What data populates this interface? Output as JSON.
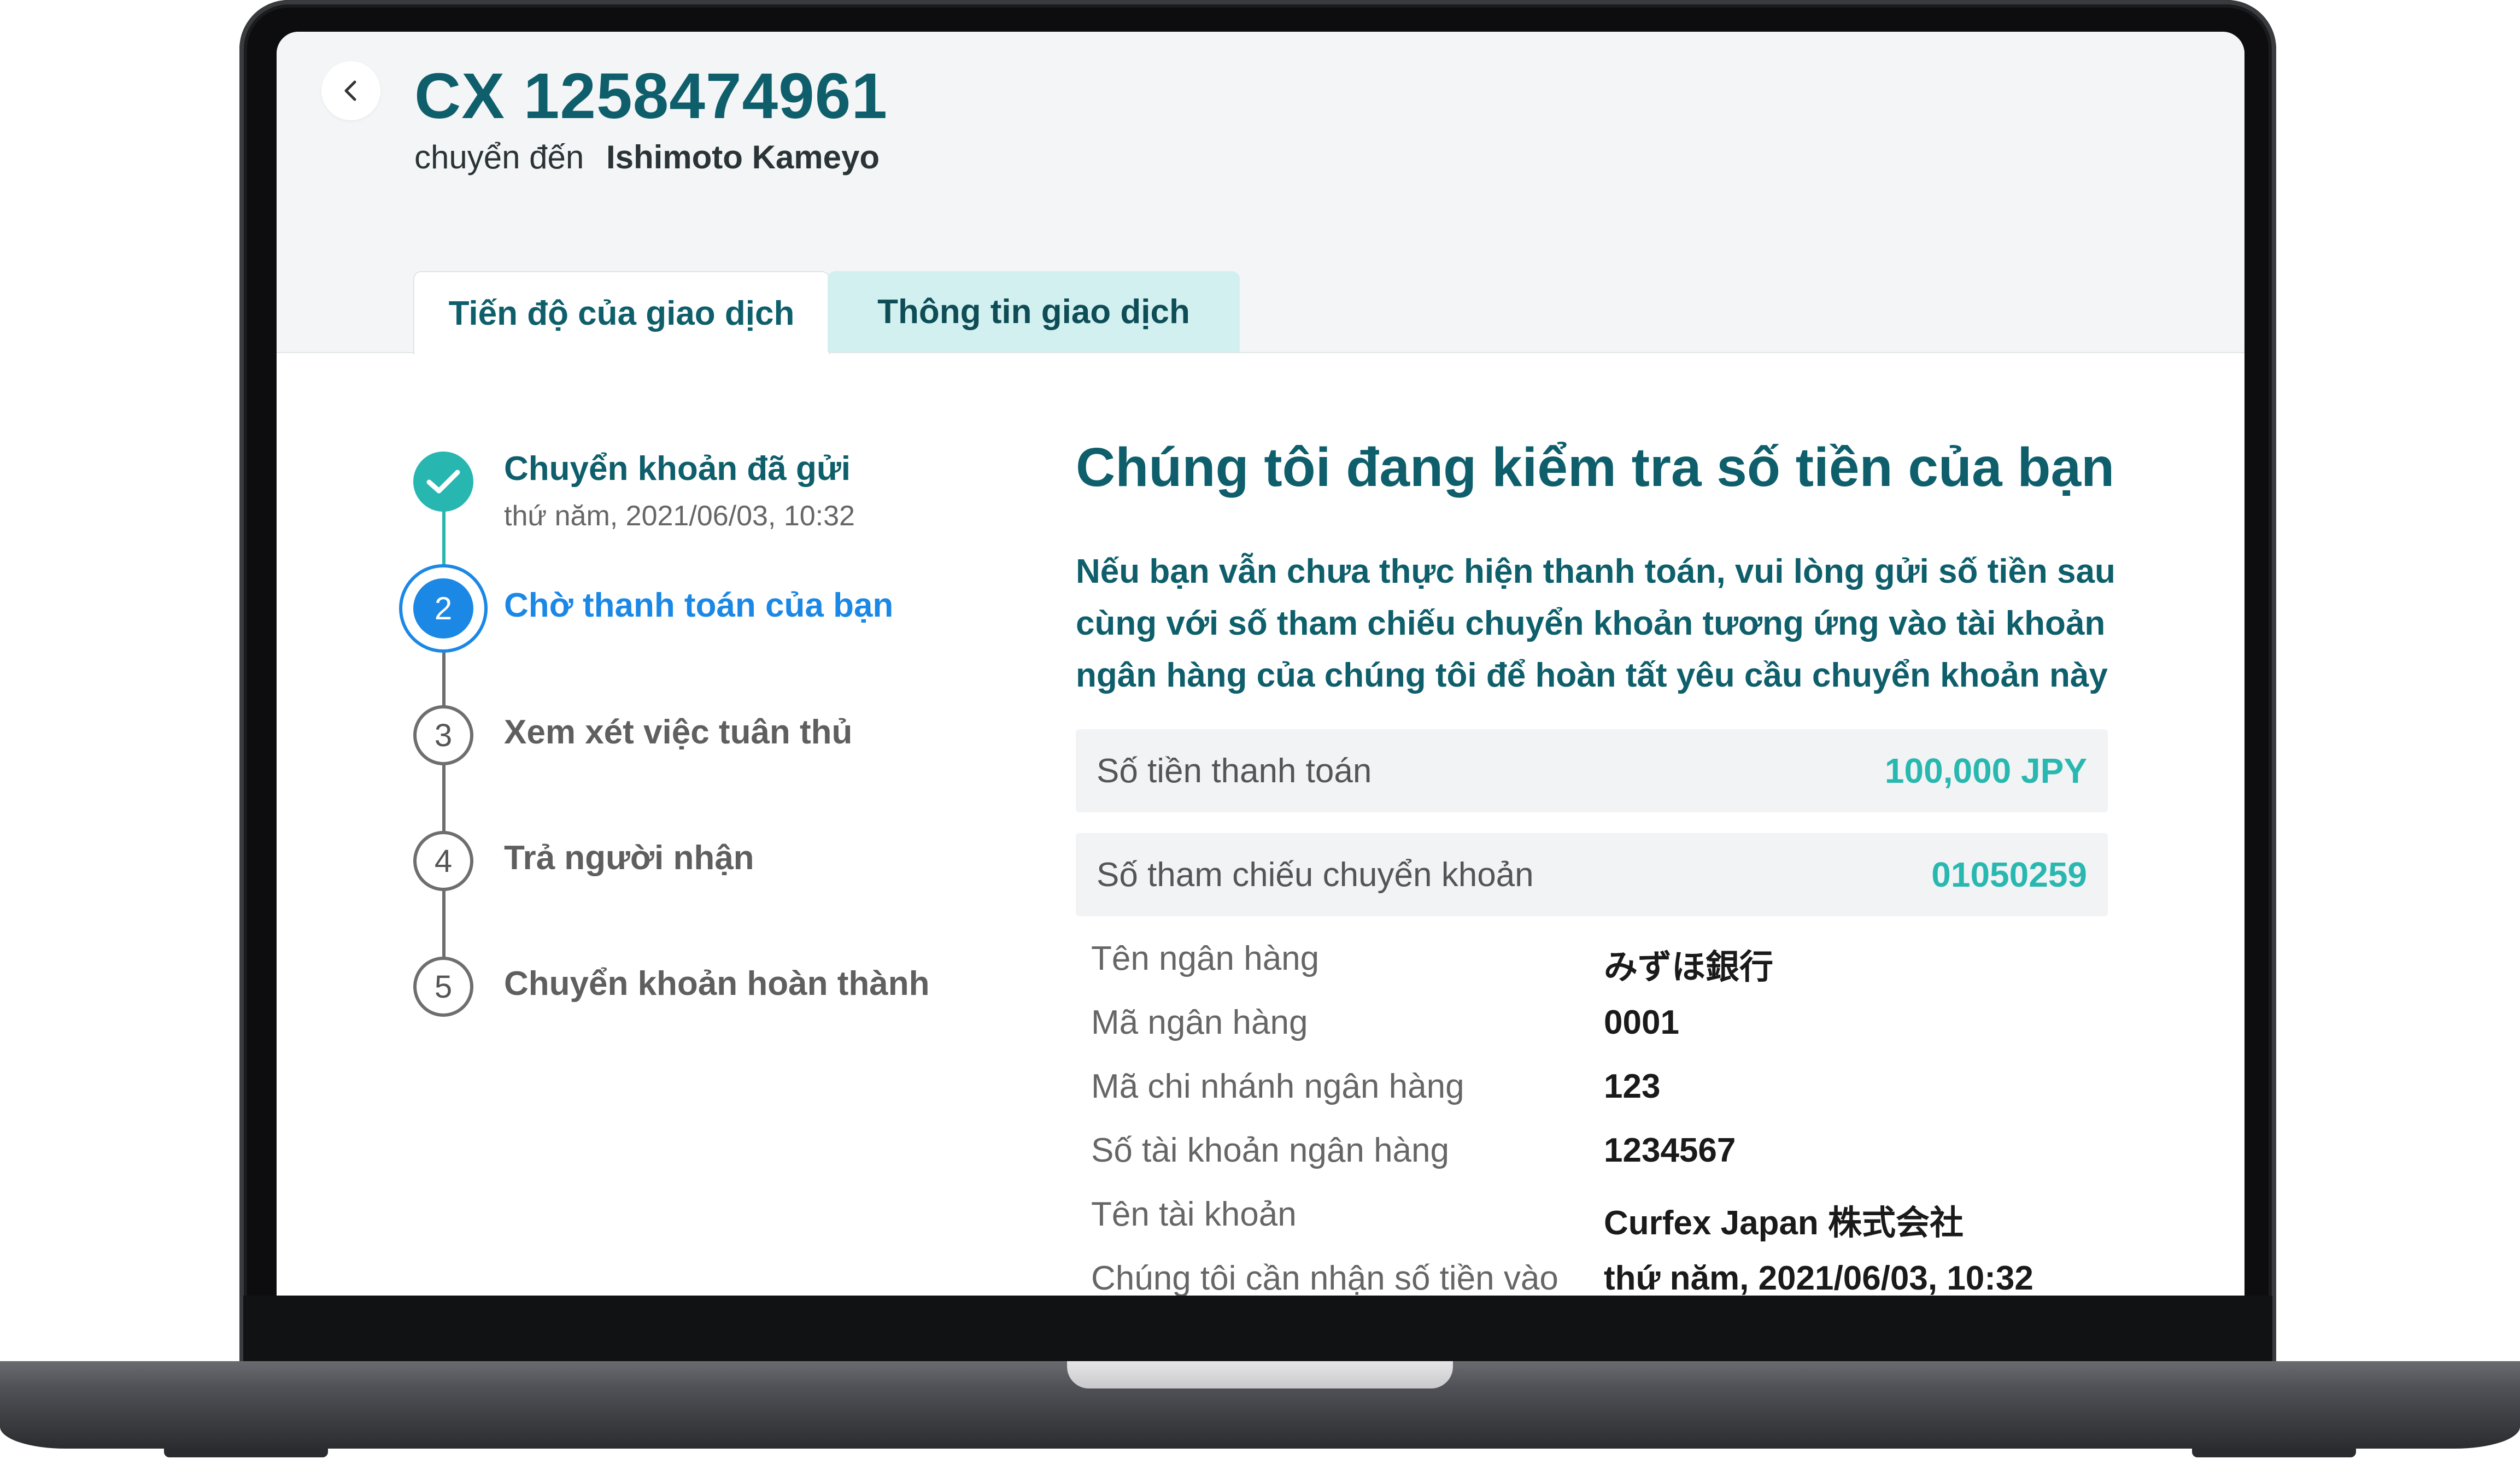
{
  "header": {
    "title": "CX 1258474961",
    "subtitle_prefix": "chuyển đến",
    "recipient": "Ishimoto Kameyo"
  },
  "tabs": [
    {
      "label": "Tiến độ của giao dịch",
      "active": true
    },
    {
      "label": "Thông tin giao dịch",
      "active": false
    }
  ],
  "steps": [
    {
      "number": "",
      "label": "Chuyển khoản đã gửi",
      "date": "thứ năm, 2021/06/03, 10:32",
      "state": "done"
    },
    {
      "number": "2",
      "label": "Chờ thanh toán của bạn",
      "state": "current"
    },
    {
      "number": "3",
      "label": "Xem xét việc tuân thủ",
      "state": "pending"
    },
    {
      "number": "4",
      "label": "Trả người nhận",
      "state": "pending"
    },
    {
      "number": "5",
      "label": "Chuyển khoản hoàn thành",
      "state": "pending"
    }
  ],
  "panel": {
    "title": "Chúng tôi đang kiểm tra số tiền của bạn",
    "description": "Nếu bạn vẫn chưa thực hiện thanh toán, vui lòng gửi số tiền sau cùng với số tham chiếu chuyển khoản tương ứng vào tài khoản ngân hàng của chúng tôi để hoàn tất yêu cầu chuyển khoản này",
    "highlights": [
      {
        "label": "Số tiền thanh toán",
        "value": "100,000 JPY"
      },
      {
        "label": "Số tham chiếu chuyển khoản",
        "value": "01050259"
      }
    ],
    "details": [
      {
        "label": "Tên ngân hàng",
        "value": "みずほ銀行"
      },
      {
        "label": "Mã ngân hàng",
        "value": "0001"
      },
      {
        "label": "Mã chi nhánh ngân hàng",
        "value": "123"
      },
      {
        "label": "Số tài khoản ngân hàng",
        "value": "1234567"
      },
      {
        "label": "Tên tài khoản",
        "value": "Curfex Japan 株式会社"
      },
      {
        "label": "Chúng tôi cần nhận số tiền vào",
        "value": "thứ năm, 2021/06/03, 10:32"
      }
    ]
  },
  "colors": {
    "brand": "#0e5f6b",
    "accent_teal": "#28b6b1",
    "active_blue": "#1b88e6",
    "inactive_tab": "#d3f0f1"
  },
  "icons": {
    "back": "chevron-left-icon",
    "done": "check-icon"
  }
}
